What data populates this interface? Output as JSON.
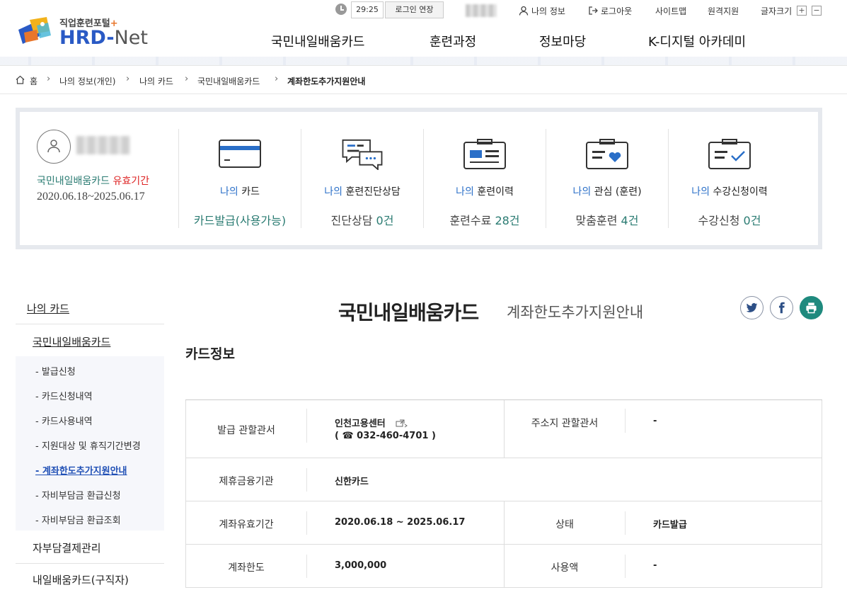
{
  "header": {
    "logo_sub": "직업훈련포털",
    "logo_sub_plus": "+",
    "logo_hrd": "HRD",
    "logo_dash": "-",
    "logo_net": "Net",
    "session_timer": "29:25",
    "extend_login": "로그인 연장",
    "util_links": {
      "my_info": "나의 정보",
      "logout": "로그아웃",
      "sitemap": "사이트맵",
      "remote_support": "원격지원",
      "font_size": "글자크기",
      "font_plus": "+",
      "font_minus": "−"
    },
    "gnb": [
      "국민내일배움카드",
      "훈련과정",
      "정보마당",
      "K-디지털 아카데미"
    ]
  },
  "breadcrumb": [
    "홈",
    "나의 정보(개인)",
    "나의 카드",
    "국민내일배움카드",
    "계좌한도추가지원안내"
  ],
  "summary": {
    "card_label": "국민내일배움카드",
    "card_label_red": "유효기간",
    "card_period": "2020.06.18~2025.06.17",
    "columns": [
      {
        "pre": "나의",
        "label": "카드",
        "value": "카드발급(사용가능)",
        "value_num": "",
        "value_suffix": ""
      },
      {
        "pre": "나의",
        "label": "훈련진단상담",
        "value": "진단상담",
        "value_num": "0",
        "value_suffix": "건"
      },
      {
        "pre": "나의",
        "label": "훈련이력",
        "value": "훈련수료",
        "value_num": "28",
        "value_suffix": "건"
      },
      {
        "pre": "나의",
        "label": "관심 (훈련)",
        "value": "맞춤훈련",
        "value_num": "4",
        "value_suffix": "건"
      },
      {
        "pre": "나의",
        "label": "수강신청이력",
        "value": "수강신청",
        "value_num": "0",
        "value_suffix": "건"
      }
    ]
  },
  "lnb": {
    "title": "나의 카드",
    "group1": "국민내일배움카드",
    "items": [
      "- 발급신청",
      "- 카드신청내역",
      "- 카드사용내역",
      "- 지원대상 및 휴직기간변경",
      "- 계좌한도추가지원안내",
      "- 자비부담금 환급신청",
      "- 자비부담금 환급조회"
    ],
    "group2": "자부담결제관리",
    "group3": "내일배움카드(구직자)"
  },
  "main": {
    "title": "국민내일배움카드",
    "subtitle": "계좌한도추가지원안내",
    "section_title": "카드정보",
    "table": {
      "issue_office_label": "발급 관할관서",
      "issue_office_value": "인천고용센터",
      "issue_office_phone": "( ☎ 032-460-4701 )",
      "address_office_label": "주소지 관할관서",
      "address_office_value": "-",
      "bank_label": "제휴금융기관",
      "bank_value": "신한카드",
      "account_period_label": "계좌유효기간",
      "account_period_value": "2020.06.18 ~ 2025.06.17",
      "status_label": "상태",
      "status_value": "카드발급",
      "limit_label": "계좌한도",
      "limit_value": "3,000,000",
      "used_label": "사용액",
      "used_value": "-"
    }
  },
  "colors": {
    "brand_blue": "#2a5ac5",
    "teal": "#2a7b72",
    "link_blue": "#2a6fc8",
    "accent_orange": "#e8762b",
    "red": "#dd2222"
  }
}
